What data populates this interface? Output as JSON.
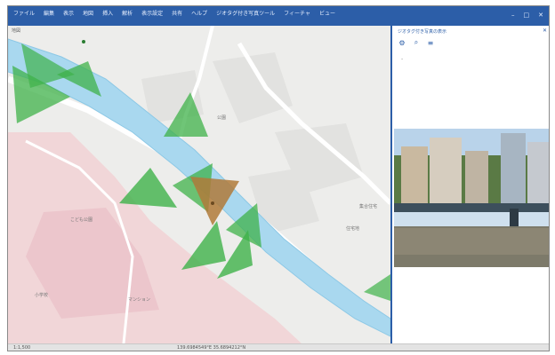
{
  "window": {
    "menu": [
      "ファイル",
      "編集",
      "表示",
      "地図",
      "挿入",
      "解析",
      "表示設定",
      "共有",
      "ヘルプ",
      "ジオタグ付き写真ツール",
      "フィーチャ",
      "ビュー"
    ],
    "controls": [
      "–",
      "□",
      "✕"
    ]
  },
  "map": {
    "tab_label": "地図",
    "labels": [
      "公園",
      "こども公園",
      "小学校",
      "集合住宅",
      "マンション",
      "住宅地"
    ],
    "colors": {
      "river": "#a9d8ef",
      "road": "#ffffff",
      "area_pink": "#f1d6d8",
      "marker": "#3fb24a",
      "selected_marker": "#b07a3a"
    }
  },
  "panel": {
    "title": "ジオタグ付き写真の表示",
    "close": "✕",
    "tools": [
      "settings-icon",
      "zoom-icon",
      "list-icon"
    ],
    "placeholder": "-",
    "photo_alt": "river-bridge-photo"
  },
  "status": {
    "scale": "1:1,500",
    "coords": "139.6984549°E 35.6894212°N"
  }
}
